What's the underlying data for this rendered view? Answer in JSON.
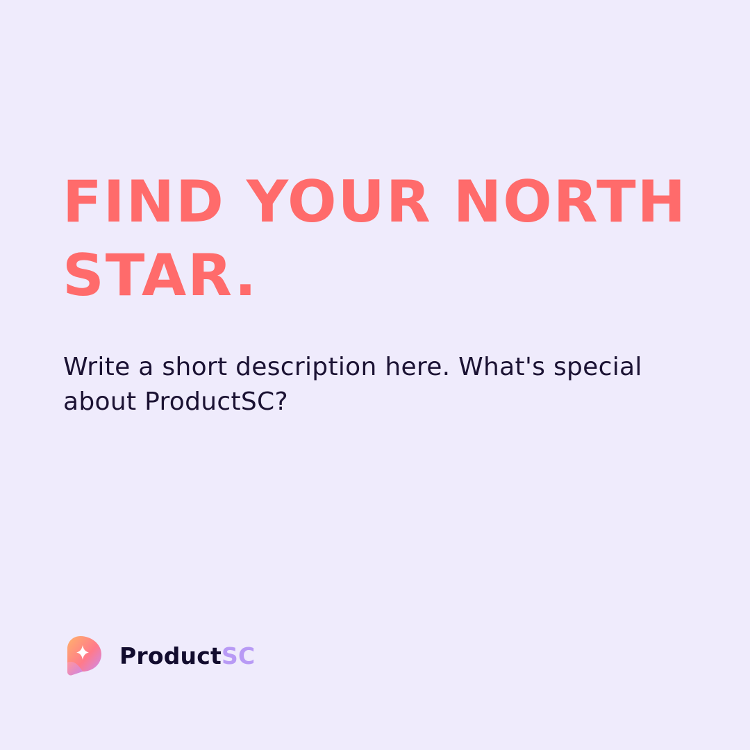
{
  "headline": "FIND YOUR NORTH\nSTAR.",
  "description": "Write a short description here. What's special\nabout ProductSC?",
  "brand": {
    "name_primary": "Product",
    "name_accent": "SC",
    "logo_icon": "sparkle-logo-icon"
  },
  "colors": {
    "background": "#EFEBFC",
    "headline": "#FF6B6B",
    "body_text": "#1B1233",
    "brand_primary": "#120C2E",
    "brand_accent": "#B89AF5"
  }
}
